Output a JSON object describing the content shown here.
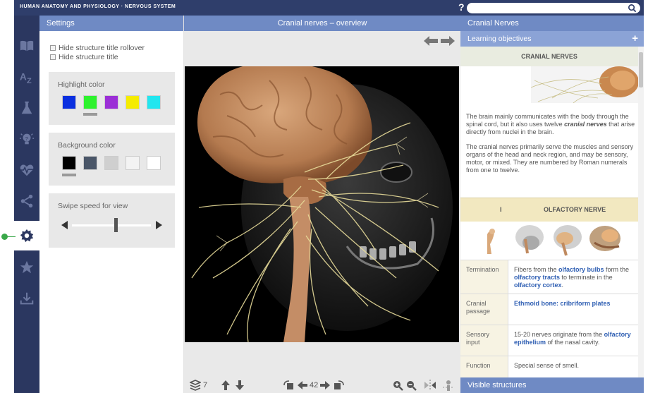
{
  "app": {
    "title": "HUMAN ANATOMY AND PHYSIOLOGY · NERVOUS SYSTEM",
    "help": "?"
  },
  "rail": {
    "items": [
      "book-icon",
      "glossary-az-icon",
      "lab-flask-icon",
      "lightbulb-icon",
      "pulse-heart-icon",
      "share-icon",
      "settings-gear-icon",
      "star-icon",
      "download-icon"
    ],
    "active": "settings-gear-icon"
  },
  "settings": {
    "title": "Settings",
    "hide_rollover": "Hide structure title rollover",
    "hide_title": "Hide structure title",
    "highlight_label": "Highlight color",
    "highlight_colors": [
      "#0a2fe0",
      "#2ef22e",
      "#9b2fd6",
      "#f5ec00",
      "#22e6ef"
    ],
    "highlight_selected": 1,
    "background_label": "Background color",
    "background_colors": [
      "#000000",
      "#4a5668",
      "#cfcfcf",
      "#f3f3f3",
      "#ffffff"
    ],
    "background_selected": 0,
    "swipe_label": "Swipe speed for view",
    "swipe_level": 0.55
  },
  "center": {
    "title": "Cranial nerves – overview",
    "layers_count": "7",
    "view_number": "42"
  },
  "right": {
    "title": "Cranial Nerves",
    "objectives": "Learning objectives",
    "objectives_toggle": "+",
    "section_title": "CRANIAL NERVES",
    "para1_a": "The brain mainly communicates with the body through the spinal cord, but it also uses twelve ",
    "para1_em": "cranial nerves",
    "para1_b": " that arise directly from nuclei in the brain.",
    "para2": "The cranial nerves primarily serve the muscles and sensory organs of the head and neck region, and may be sensory, motor, or mixed. They are numbered by Roman numerals from one to twelve.",
    "nerve_numeral": "I",
    "nerve_name": "OLFACTORY NERVE",
    "rows": [
      {
        "label": "Termination",
        "t1": "Fibers from the ",
        "l1": "olfactory bulbs",
        "t2": " form the ",
        "l2": "olfactory tracts",
        "t3": " to terminate in the ",
        "l3": "olfactory cortex",
        "t4": "."
      },
      {
        "label": "Cranial passage",
        "l1": "Ethmoid bone: cribriform plates"
      },
      {
        "label": "Sensory input",
        "t1": "15-20 nerves originate from the ",
        "l1": "olfactory epithelium",
        "t2": " of the nasal cavity."
      },
      {
        "label": "Function",
        "t1": "Special sense of smell."
      }
    ],
    "visible": "Visible structures"
  }
}
